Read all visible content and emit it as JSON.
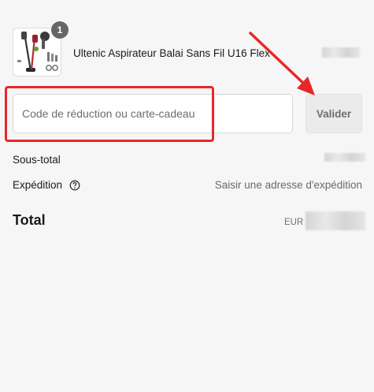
{
  "product": {
    "name": "Ultenic Aspirateur Balai Sans Fil U16 Flex",
    "quantity": "1",
    "image_icon": "vacuum-cleaner-kit-image"
  },
  "discount": {
    "placeholder": "Code de réduction ou carte-cadeau",
    "value": "",
    "button_label": "Valider"
  },
  "summary": {
    "subtotal_label": "Sous-total",
    "shipping_label": "Expédition",
    "shipping_value": "Saisir une adresse d'expédition",
    "total_label": "Total",
    "currency": "EUR"
  },
  "annotation": {
    "highlight_color": "#e8272a",
    "arrow_color": "#e8272a"
  },
  "colors": {
    "background": "#f6f6f6",
    "badge": "#666666",
    "button_bg": "#ebebeb"
  }
}
